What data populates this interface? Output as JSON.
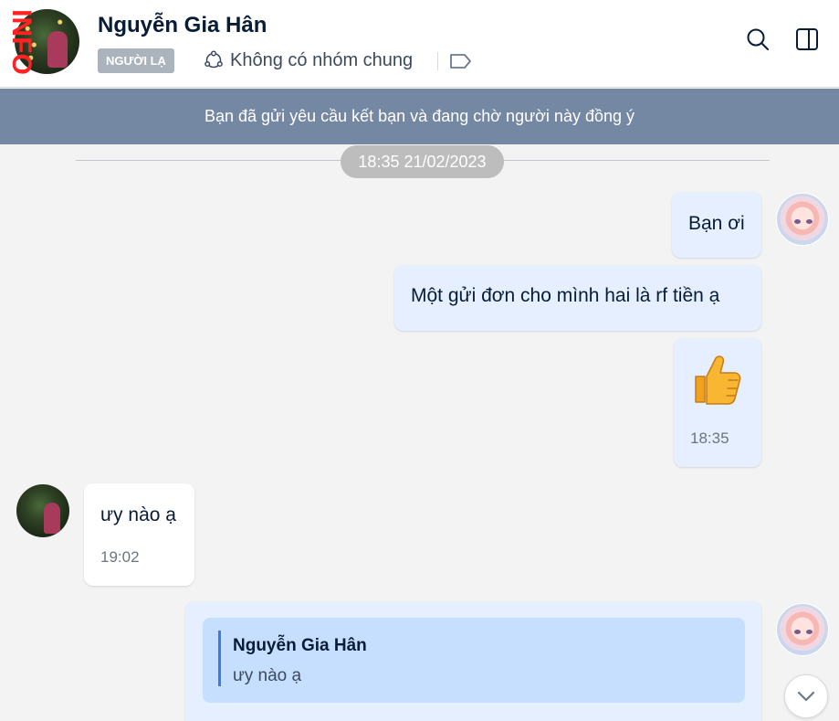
{
  "header": {
    "contact_name": "Nguyễn Gia Hân",
    "stranger_tag": "NGƯỜI LẠ",
    "mutual_groups": "Không có nhóm chung",
    "avatar_icon": "contact-avatar",
    "overlay_badge": "INFO",
    "actions": [
      {
        "icon": "search-icon"
      },
      {
        "icon": "sidebar-toggle-icon"
      }
    ]
  },
  "banner": {
    "text": "Bạn đã gửi yêu cầu kết bạn và đang chờ người này đồng ý"
  },
  "time_divider": {
    "text": "18:35 21/02/2023"
  },
  "messages": [
    {
      "from": "me",
      "text": "Bạn ơi"
    },
    {
      "from": "me",
      "text": "Một gửi đơn cho mình hai là rf tiền ạ"
    },
    {
      "from": "me",
      "sticker": "thumbs-up",
      "time": "18:35"
    },
    {
      "from": "them",
      "text": "ưy nào ạ",
      "time": "19:02"
    },
    {
      "from": "me",
      "quote": {
        "author": "Nguyễn Gia Hân",
        "text": "ưy nào ạ"
      }
    }
  ],
  "colors": {
    "banner_bg": "#7588a3",
    "my_bubble": "#e5efff",
    "their_bubble": "#ffffff",
    "quote_bg": "#c7dfff",
    "accent": "#3e7be0"
  }
}
